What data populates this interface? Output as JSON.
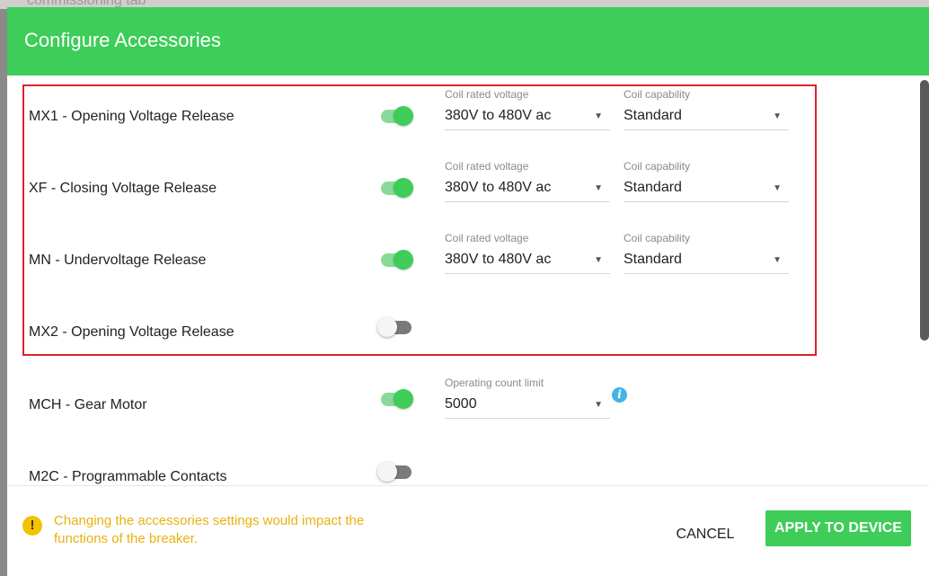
{
  "background": {
    "ghost_text": "commissioning tab"
  },
  "dialog": {
    "title": "Configure Accessories",
    "colors": {
      "brand": "#3dcd58",
      "highlight": "#d9232d",
      "warning": "#e8b112",
      "info": "#42b4e6"
    }
  },
  "accessories": [
    {
      "label": "MX1 - Opening Voltage Release",
      "enabled": true,
      "fields": [
        {
          "label": "Coil rated voltage",
          "value": "380V to 480V ac"
        },
        {
          "label": "Coil capability",
          "value": "Standard"
        }
      ]
    },
    {
      "label": "XF - Closing Voltage Release",
      "enabled": true,
      "fields": [
        {
          "label": "Coil rated voltage",
          "value": "380V to 480V ac"
        },
        {
          "label": "Coil capability",
          "value": "Standard"
        }
      ]
    },
    {
      "label": "MN - Undervoltage Release",
      "enabled": true,
      "fields": [
        {
          "label": "Coil rated voltage",
          "value": "380V to 480V ac"
        },
        {
          "label": "Coil capability",
          "value": "Standard"
        }
      ]
    },
    {
      "label": "MX2 - Opening Voltage Release",
      "enabled": false,
      "fields": []
    },
    {
      "label": "MCH - Gear Motor",
      "enabled": true,
      "fields": [
        {
          "label": "Operating count limit",
          "value": "5000"
        }
      ],
      "info_icon": "info-icon"
    },
    {
      "label": "M2C - Programmable Contacts",
      "enabled": false,
      "fields": []
    }
  ],
  "footer": {
    "warning_icon": "warning-icon",
    "warning_text": "Changing the accessories settings would impact the functions of the breaker.",
    "cancel_label": "CANCEL",
    "apply_label": "APPLY TO DEVICE"
  }
}
